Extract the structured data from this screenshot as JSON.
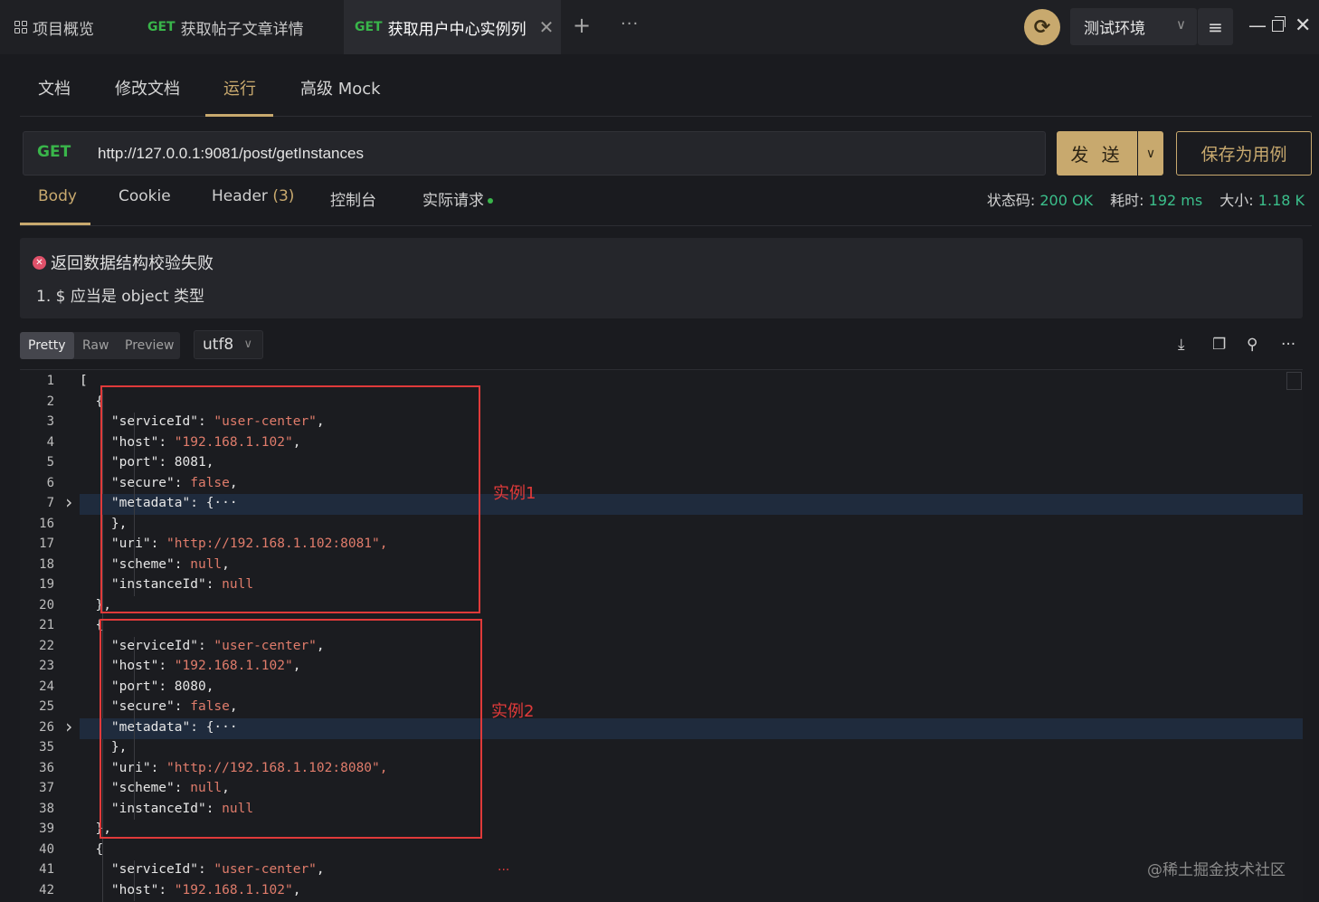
{
  "top_tabs": [
    {
      "label": "项目概览",
      "method": ""
    },
    {
      "label": "获取帖子文章详情",
      "method": "GET"
    },
    {
      "label": "获取用户中心实例列",
      "method": "GET"
    }
  ],
  "env": {
    "label": "测试环境"
  },
  "sub_tabs": [
    "文档",
    "修改文档",
    "运行",
    "高级 Mock"
  ],
  "request": {
    "method": "GET",
    "url": "http://127.0.0.1:9081/post/getInstances",
    "send_label": "发 送",
    "save_label": "保存为用例"
  },
  "resp_tabs": {
    "body": "Body",
    "cookie": "Cookie",
    "header": "Header",
    "header_count": "(3)",
    "console": "控制台",
    "actual": "实际请求"
  },
  "stats": {
    "status_label": "状态码:",
    "status_value": "200 OK",
    "time_label": "耗时:",
    "time_value": "192 ms",
    "size_label": "大小:",
    "size_value": "1.18 K"
  },
  "validation": {
    "title": "返回数据结构校验失败",
    "item": "1. $ 应当是 object 类型"
  },
  "format": {
    "pretty": "Pretty",
    "raw": "Raw",
    "preview": "Preview",
    "encoding": "utf8"
  },
  "annotations": {
    "box1": "实例1",
    "box2": "实例2",
    "ellipsis": "..."
  },
  "watermark": "@稀土掘金技术社区",
  "code_lines": [
    {
      "n": "1",
      "t": "["
    },
    {
      "n": "2",
      "t": "  {"
    },
    {
      "n": "3",
      "t": "    \"serviceId\": \"user-center\","
    },
    {
      "n": "4",
      "t": "    \"host\": \"192.168.1.102\","
    },
    {
      "n": "5",
      "t": "    \"port\": 8081,"
    },
    {
      "n": "6",
      "t": "    \"secure\": false,"
    },
    {
      "n": "7",
      "t": "    \"metadata\": {···"
    },
    {
      "n": "16",
      "t": "    },"
    },
    {
      "n": "17",
      "t": "    \"uri\": \"http://192.168.1.102:8081\","
    },
    {
      "n": "18",
      "t": "    \"scheme\": null,"
    },
    {
      "n": "19",
      "t": "    \"instanceId\": null"
    },
    {
      "n": "20",
      "t": "  },"
    },
    {
      "n": "21",
      "t": "  {"
    },
    {
      "n": "22",
      "t": "    \"serviceId\": \"user-center\","
    },
    {
      "n": "23",
      "t": "    \"host\": \"192.168.1.102\","
    },
    {
      "n": "24",
      "t": "    \"port\": 8080,"
    },
    {
      "n": "25",
      "t": "    \"secure\": false,"
    },
    {
      "n": "26",
      "t": "    \"metadata\": {···"
    },
    {
      "n": "35",
      "t": "    },"
    },
    {
      "n": "36",
      "t": "    \"uri\": \"http://192.168.1.102:8080\","
    },
    {
      "n": "37",
      "t": "    \"scheme\": null,"
    },
    {
      "n": "38",
      "t": "    \"instanceId\": null"
    },
    {
      "n": "39",
      "t": "  },"
    },
    {
      "n": "40",
      "t": "  {"
    },
    {
      "n": "41",
      "t": "    \"serviceId\": \"user-center\","
    },
    {
      "n": "42",
      "t": "    \"host\": \"192.168.1.102\","
    }
  ],
  "colors": {
    "accent": "#c8a96e",
    "method": "#39b54a",
    "string": "#e07c6b",
    "annotation": "#e03a3a",
    "stat_value": "#3bbf8b"
  }
}
